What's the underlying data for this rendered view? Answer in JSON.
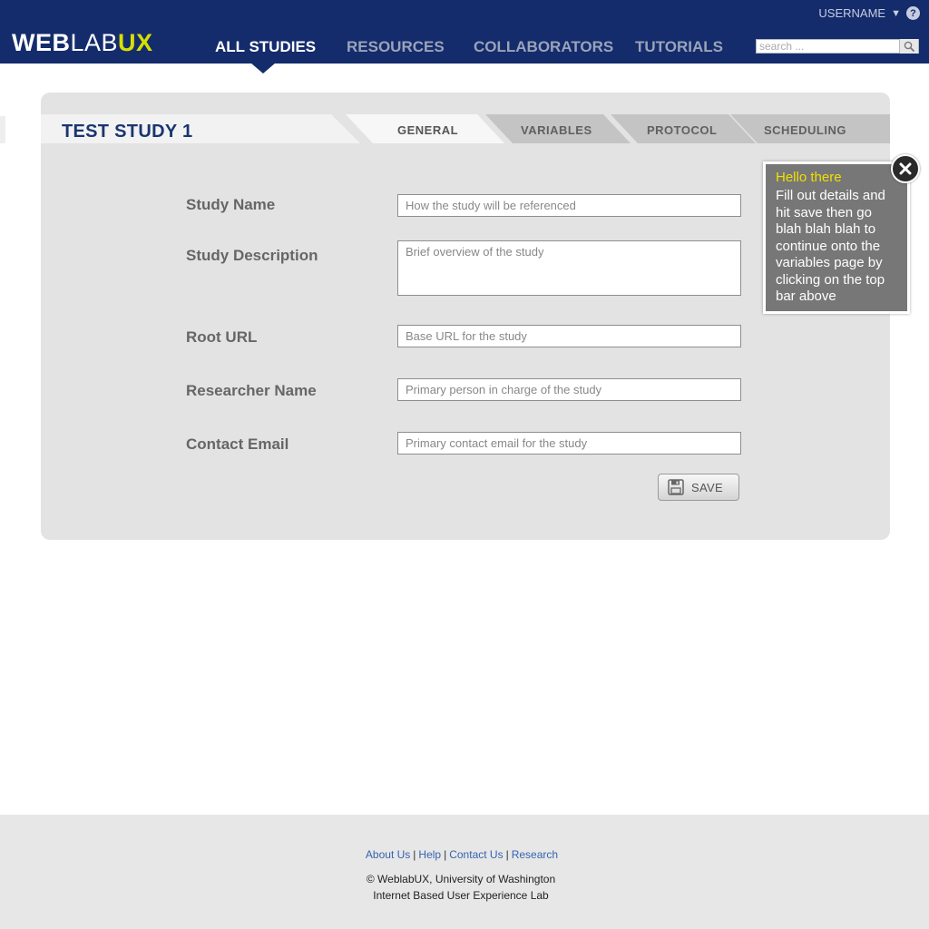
{
  "header": {
    "logo": {
      "part1": "WEB",
      "part2": "LAB",
      "part3": "UX"
    },
    "username": "USERNAME",
    "nav": [
      {
        "label": "ALL STUDIES",
        "active": true
      },
      {
        "label": "RESOURCES",
        "active": false
      },
      {
        "label": "COLLABORATORS",
        "active": false
      },
      {
        "label": "TUTORIALS",
        "active": false
      }
    ],
    "search_placeholder": "search ..."
  },
  "study": {
    "title": "TEST STUDY 1",
    "tabs": [
      {
        "label": "GENERAL",
        "active": true
      },
      {
        "label": "VARIABLES",
        "active": false
      },
      {
        "label": "PROTOCOL",
        "active": false
      },
      {
        "label": "SCHEDULING",
        "active": false
      }
    ]
  },
  "form": {
    "fields": [
      {
        "label": "Study Name",
        "placeholder": "How the study will be referenced",
        "value": ""
      },
      {
        "label": "Study Description",
        "placeholder": "Brief overview of the study",
        "value": ""
      },
      {
        "label": "Root URL",
        "placeholder": "Base URL for the study",
        "value": ""
      },
      {
        "label": "Researcher Name",
        "placeholder": "Primary person in charge of the study",
        "value": ""
      },
      {
        "label": "Contact Email",
        "placeholder": "Primary contact email for the study",
        "value": ""
      }
    ],
    "save_label": "SAVE"
  },
  "tooltip": {
    "title": "Hello there",
    "body": "Fill out details and hit save then go blah blah blah to continue onto the variables page by clicking on the top bar above"
  },
  "footer": {
    "links": [
      "About Us",
      "Help",
      "Contact Us",
      "Research"
    ],
    "separator": "|",
    "copyright": "© WeblabUX, University of Washington",
    "subtitle": "Internet Based User Experience Lab"
  },
  "colors": {
    "header_bg": "#142c6c",
    "accent": "#d6e000",
    "panel_bg": "#e3e3e3",
    "tooltip_bg": "#777777",
    "tooltip_title": "#f0e000",
    "link": "#3563b0"
  }
}
